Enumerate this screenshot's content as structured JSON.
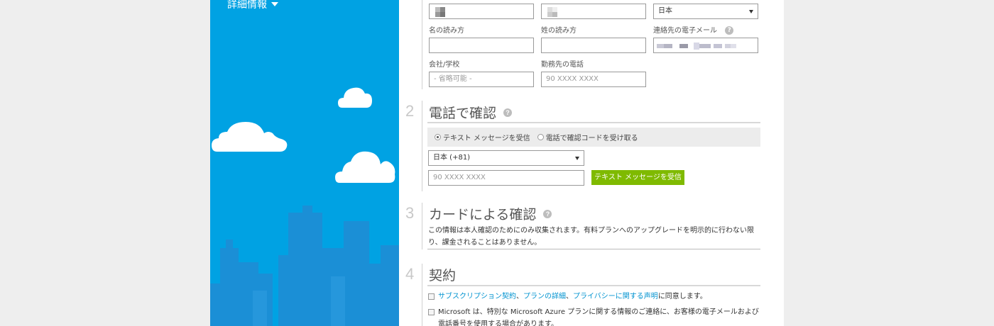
{
  "sidebar": {
    "details_toggle": "詳細情報"
  },
  "profile": {
    "country_value": "日本",
    "given_name_reading_label": "名の読み方",
    "family_name_reading_label": "姓の読み方",
    "contact_email_label": "連絡先の電子メール",
    "company_label": "会社/学校",
    "company_placeholder": "- 省略可能 -",
    "work_phone_label": "勤務先の電話",
    "work_phone_placeholder": "90 XXXX XXXX"
  },
  "step2": {
    "number": "2",
    "title": "電話で確認",
    "radio_text": "テキスト メッセージを受信",
    "radio_call": "電話で確認コードを受け取る",
    "country_code": "日本 (+81)",
    "phone_placeholder": "90 XXXX XXXX",
    "send_button": "テキスト メッセージを受信"
  },
  "step3": {
    "number": "3",
    "title": "カードによる確認",
    "description": "この情報は本人確認のためにのみ収集されます。有料プランへのアップグレードを明示的に行わない限り、課金されることはありません。"
  },
  "step4": {
    "number": "4",
    "title": "契約",
    "agree_link_subscription": "サブスクリプション契約",
    "agree_sep1": "、",
    "agree_link_plan": "プランの詳細",
    "agree_sep2": "、",
    "agree_link_privacy": "プライバシーに関する声明",
    "agree_suffix": "に同意します。",
    "offers_text": "Microsoft は、特別な Microsoft Azure プランに関する情報のご連絡に、お客様の電子メールおよび電話番号を使用する場合があります。"
  },
  "help_glyph": "?"
}
